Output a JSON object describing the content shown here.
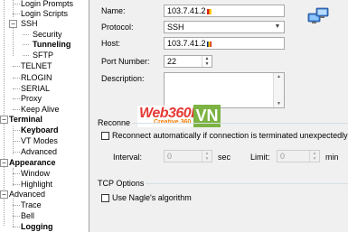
{
  "tree": {
    "login_prompts": "Login Prompts",
    "login_scripts": "Login Scripts",
    "ssh": "SSH",
    "security": "Security",
    "tunneling": "Tunneling",
    "sftp": "SFTP",
    "telnet": "TELNET",
    "rlogin": "RLOGIN",
    "serial": "SERIAL",
    "proxy": "Proxy",
    "keep_alive": "Keep Alive",
    "terminal": "Terminal",
    "keyboard": "Keyboard",
    "vt_modes": "VT Modes",
    "terminal_advanced": "Advanced",
    "appearance": "Appearance",
    "window": "Window",
    "highlight": "Highlight",
    "advanced": "Advanced",
    "trace": "Trace",
    "bell": "Bell",
    "logging": "Logging"
  },
  "form": {
    "name_label": "Name:",
    "name_value": "103.7.41.2",
    "protocol_label": "Protocol:",
    "protocol_value": "SSH",
    "host_label": "Host:",
    "host_value": "103.7.41.2",
    "port_label": "Port Number:",
    "port_value": "22",
    "description_label": "Description:"
  },
  "reconnect": {
    "group_title": "Reconne",
    "checkbox_label": "Reconnect automatically if connection is terminated unexpectedly",
    "interval_label": "Interval:",
    "interval_value": "0",
    "interval_unit": "sec",
    "limit_label": "Limit:",
    "limit_value": "0",
    "limit_unit": "min"
  },
  "tcp": {
    "group_title": "TCP Options",
    "nagle_label": "Use Nagle's algorithm"
  },
  "watermark": {
    "brand": "Web360DO",
    "sub": "Creative 360",
    "vn": "VN"
  },
  "colors": {
    "flag_red": "#da251d",
    "flag_yellow": "#ffcd00",
    "watermark_red": "#e53935",
    "watermark_green": "#7cb342"
  },
  "icons": {
    "session": "computers-network-icon",
    "dropdown": "chevron-down-icon",
    "spin": "spin-arrows-icon"
  }
}
